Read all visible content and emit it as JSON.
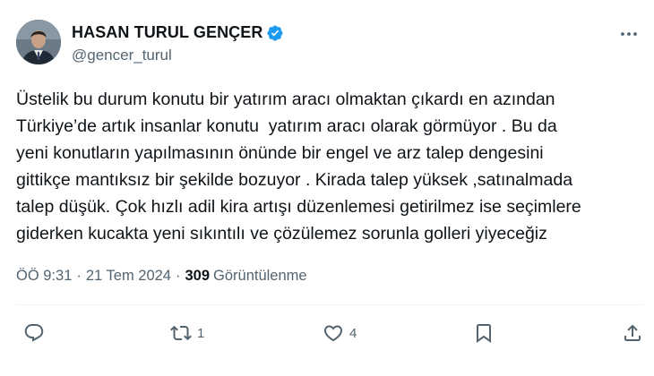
{
  "author": {
    "display_name": "HASAN TURUL GENÇER",
    "handle": "@gencer_turul",
    "verified": true
  },
  "tweet": {
    "text": "Üstelik bu durum konutu bir yatırım aracı olmaktan çıkardı en azından\nTürkiye’de artık insanlar konutu  yatırım aracı olarak görmüyor . Bu da\nyeni konutların yapılmasının önünde bir engel ve arz talep dengesini\ngittikçe mantıksız bir şekilde bozuyor . Kirada talep yüksek ,satınalmada\ntalep düşük. Çok hızlı adil kira artışı düzenlemesi getirilmez ise seçimlere\ngiderken kucakta yeni sıkıntılı ve çözülemez sorunla golleri yiyeceğiz"
  },
  "meta": {
    "time": "ÖÖ 9:31",
    "separator": "·",
    "date": "21 Tem 2024",
    "views_count": "309",
    "views_label": "Görüntülenme"
  },
  "actions": {
    "reply_count": "",
    "retweet_count": "1",
    "like_count": "4"
  },
  "colors": {
    "text": "#0f1419",
    "secondary": "#536471",
    "verified": "#1d9bf0",
    "divider": "#eff3f4"
  },
  "icons": [
    "verified-badge-icon",
    "more-icon",
    "reply-icon",
    "retweet-icon",
    "like-icon",
    "bookmark-icon",
    "share-icon"
  ]
}
